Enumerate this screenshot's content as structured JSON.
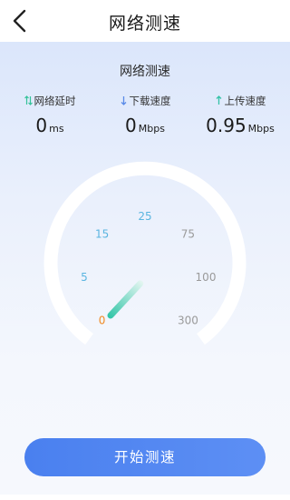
{
  "header": {
    "title": "网络测速",
    "back_icon": "chevron-left-icon"
  },
  "panel": {
    "title": "网络测速",
    "stats": [
      {
        "label": "网络延时",
        "value": "0",
        "unit": "ms",
        "icon": "swap-vertical-icon",
        "icon_color": "#35c29a"
      },
      {
        "label": "下载速度",
        "value": "0",
        "unit": "Mbps",
        "icon": "arrow-down-icon",
        "icon_color": "#5a8be8"
      },
      {
        "label": "上传速度",
        "value": "0.95",
        "unit": "Mbps",
        "icon": "arrow-up-icon",
        "icon_color": "#35c2a8"
      }
    ]
  },
  "gauge": {
    "ticks": [
      {
        "label": "0",
        "color": "#f08a24"
      },
      {
        "label": "5",
        "color": "#5ab5e0"
      },
      {
        "label": "15",
        "color": "#5ab5e0"
      },
      {
        "label": "25",
        "color": "#5ab5e0"
      },
      {
        "label": "75",
        "color": "#9a9a9a"
      },
      {
        "label": "100",
        "color": "#9a9a9a"
      },
      {
        "label": "300",
        "color": "#9a9a9a"
      }
    ],
    "needle_color_start": "#2ec4a6",
    "needle_color_end": "#e6f6f2",
    "speed": 0
  },
  "actions": {
    "start_label": "开始测速"
  }
}
